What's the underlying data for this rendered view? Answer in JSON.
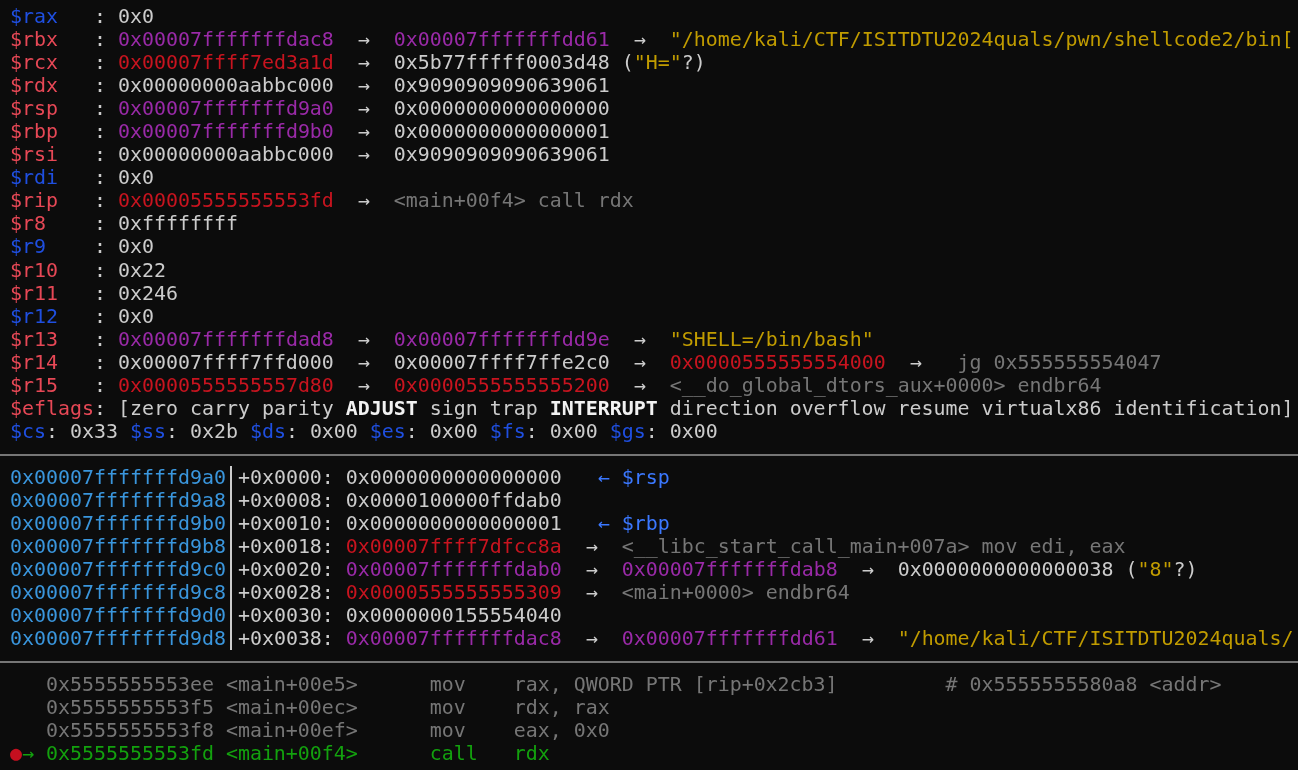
{
  "registers": [
    [
      {
        "kind": "reg_blue",
        "text": "$rax"
      },
      {
        "kind": "plain",
        "text": "   : 0x0"
      }
    ],
    [
      {
        "kind": "reg_red",
        "text": "$rbx"
      },
      {
        "kind": "plain",
        "text": "   : "
      },
      {
        "kind": "purple",
        "text": "0x00007fffffffdac8"
      },
      {
        "kind": "arrow",
        "text": "  →  "
      },
      {
        "kind": "purple",
        "text": "0x00007fffffffdd61"
      },
      {
        "kind": "arrow",
        "text": "  →  "
      },
      {
        "kind": "yellow",
        "text": "\"/home/kali/CTF/ISITDTU2024quals/pwn/shellcode2/bin["
      }
    ],
    [
      {
        "kind": "reg_red",
        "text": "$rcx"
      },
      {
        "kind": "plain",
        "text": "   : "
      },
      {
        "kind": "red",
        "text": "0x00007ffff7ed3a1d"
      },
      {
        "kind": "arrow",
        "text": "  →  "
      },
      {
        "kind": "plain",
        "text": "0x5b77fffff0003d48 ("
      },
      {
        "kind": "yellow",
        "text": "\"H=\""
      },
      {
        "kind": "plain",
        "text": "?)"
      }
    ],
    [
      {
        "kind": "reg_red",
        "text": "$rdx"
      },
      {
        "kind": "plain",
        "text": "   : 0x00000000aabbc000"
      },
      {
        "kind": "arrow",
        "text": "  →  "
      },
      {
        "kind": "plain",
        "text": "0x9090909090639061"
      }
    ],
    [
      {
        "kind": "reg_red",
        "text": "$rsp"
      },
      {
        "kind": "plain",
        "text": "   : "
      },
      {
        "kind": "purple",
        "text": "0x00007fffffffd9a0"
      },
      {
        "kind": "arrow",
        "text": "  →  "
      },
      {
        "kind": "plain",
        "text": "0x0000000000000000"
      }
    ],
    [
      {
        "kind": "reg_red",
        "text": "$rbp"
      },
      {
        "kind": "plain",
        "text": "   : "
      },
      {
        "kind": "purple",
        "text": "0x00007fffffffd9b0"
      },
      {
        "kind": "arrow",
        "text": "  →  "
      },
      {
        "kind": "plain",
        "text": "0x0000000000000001"
      }
    ],
    [
      {
        "kind": "reg_red",
        "text": "$rsi"
      },
      {
        "kind": "plain",
        "text": "   : 0x00000000aabbc000"
      },
      {
        "kind": "arrow",
        "text": "  →  "
      },
      {
        "kind": "plain",
        "text": "0x9090909090639061"
      }
    ],
    [
      {
        "kind": "reg_blue",
        "text": "$rdi"
      },
      {
        "kind": "plain",
        "text": "   : 0x0"
      }
    ],
    [
      {
        "kind": "reg_red",
        "text": "$rip"
      },
      {
        "kind": "plain",
        "text": "   : "
      },
      {
        "kind": "red",
        "text": "0x00005555555553fd"
      },
      {
        "kind": "arrow",
        "text": "  →  "
      },
      {
        "kind": "grey",
        "text": "<main+00f4> call rdx"
      }
    ],
    [
      {
        "kind": "reg_red",
        "text": "$r8"
      },
      {
        "kind": "plain",
        "text": "    : 0xffffffff"
      }
    ],
    [
      {
        "kind": "reg_blue",
        "text": "$r9"
      },
      {
        "kind": "plain",
        "text": "    : 0x0"
      }
    ],
    [
      {
        "kind": "reg_red",
        "text": "$r10"
      },
      {
        "kind": "plain",
        "text": "   : 0x22"
      }
    ],
    [
      {
        "kind": "reg_red",
        "text": "$r11"
      },
      {
        "kind": "plain",
        "text": "   : 0x246"
      }
    ],
    [
      {
        "kind": "reg_blue",
        "text": "$r12"
      },
      {
        "kind": "plain",
        "text": "   : 0x0"
      }
    ],
    [
      {
        "kind": "reg_red",
        "text": "$r13"
      },
      {
        "kind": "plain",
        "text": "   : "
      },
      {
        "kind": "purple",
        "text": "0x00007fffffffdad8"
      },
      {
        "kind": "arrow",
        "text": "  →  "
      },
      {
        "kind": "purple",
        "text": "0x00007fffffffdd9e"
      },
      {
        "kind": "arrow",
        "text": "  →  "
      },
      {
        "kind": "yellow",
        "text": "\"SHELL=/bin/bash\""
      }
    ],
    [
      {
        "kind": "reg_red",
        "text": "$r14"
      },
      {
        "kind": "plain",
        "text": "   : 0x00007ffff7ffd000"
      },
      {
        "kind": "arrow",
        "text": "  →  "
      },
      {
        "kind": "plain",
        "text": "0x00007ffff7ffe2c0"
      },
      {
        "kind": "arrow",
        "text": "  →  "
      },
      {
        "kind": "red",
        "text": "0x0000555555554000"
      },
      {
        "kind": "arrow",
        "text": "  →  "
      },
      {
        "kind": "grey",
        "text": " jg 0x555555554047"
      }
    ],
    [
      {
        "kind": "reg_red",
        "text": "$r15"
      },
      {
        "kind": "plain",
        "text": "   : "
      },
      {
        "kind": "red",
        "text": "0x0000555555557d80"
      },
      {
        "kind": "arrow",
        "text": "  →  "
      },
      {
        "kind": "red",
        "text": "0x0000555555555200"
      },
      {
        "kind": "arrow",
        "text": "  →  "
      },
      {
        "kind": "grey",
        "text": "<__do_global_dtors_aux+0000> endbr64"
      }
    ],
    [
      {
        "kind": "reg_red",
        "text": "$eflags"
      },
      {
        "kind": "plain",
        "text": ": [zero carry parity "
      },
      {
        "kind": "bold",
        "text": "ADJUST"
      },
      {
        "kind": "plain",
        "text": " sign trap "
      },
      {
        "kind": "bold",
        "text": "INTERRUPT"
      },
      {
        "kind": "plain",
        "text": " direction overflow resume virtualx86 identification]"
      }
    ],
    [
      {
        "kind": "reg_blue",
        "text": "$cs"
      },
      {
        "kind": "plain",
        "text": ": 0x33 "
      },
      {
        "kind": "reg_blue",
        "text": "$ss"
      },
      {
        "kind": "plain",
        "text": ": 0x2b "
      },
      {
        "kind": "reg_blue",
        "text": "$ds"
      },
      {
        "kind": "plain",
        "text": ": 0x00 "
      },
      {
        "kind": "reg_blue",
        "text": "$es"
      },
      {
        "kind": "plain",
        "text": ": 0x00 "
      },
      {
        "kind": "reg_blue",
        "text": "$fs"
      },
      {
        "kind": "plain",
        "text": ": 0x00 "
      },
      {
        "kind": "reg_blue",
        "text": "$gs"
      },
      {
        "kind": "plain",
        "text": ": 0x00"
      }
    ]
  ],
  "stack": [
    {
      "address": "0x00007fffffffd9a0",
      "segments": [
        {
          "kind": "plain",
          "text": "+0x0000: 0x0000000000000000"
        },
        {
          "kind": "blue",
          "text": "   ← $rsp"
        }
      ]
    },
    {
      "address": "0x00007fffffffd9a8",
      "segments": [
        {
          "kind": "plain",
          "text": "+0x0008: 0x0000100000ffdab0"
        }
      ]
    },
    {
      "address": "0x00007fffffffd9b0",
      "segments": [
        {
          "kind": "plain",
          "text": "+0x0010: 0x0000000000000001"
        },
        {
          "kind": "blue",
          "text": "   ← $rbp"
        }
      ]
    },
    {
      "address": "0x00007fffffffd9b8",
      "segments": [
        {
          "kind": "plain",
          "text": "+0x0018: "
        },
        {
          "kind": "red",
          "text": "0x00007ffff7dfcc8a"
        },
        {
          "kind": "arrow",
          "text": "  →  "
        },
        {
          "kind": "grey",
          "text": "<__libc_start_call_main+007a> mov edi, eax"
        }
      ]
    },
    {
      "address": "0x00007fffffffd9c0",
      "segments": [
        {
          "kind": "plain",
          "text": "+0x0020: "
        },
        {
          "kind": "purple",
          "text": "0x00007fffffffdab0"
        },
        {
          "kind": "arrow",
          "text": "  →  "
        },
        {
          "kind": "purple",
          "text": "0x00007fffffffdab8"
        },
        {
          "kind": "arrow",
          "text": "  →  "
        },
        {
          "kind": "plain",
          "text": "0x0000000000000038 ("
        },
        {
          "kind": "yellow",
          "text": "\"8\""
        },
        {
          "kind": "plain",
          "text": "?)"
        }
      ]
    },
    {
      "address": "0x00007fffffffd9c8",
      "segments": [
        {
          "kind": "plain",
          "text": "+0x0028: "
        },
        {
          "kind": "red",
          "text": "0x0000555555555309"
        },
        {
          "kind": "arrow",
          "text": "  →  "
        },
        {
          "kind": "grey",
          "text": "<main+0000> endbr64"
        }
      ]
    },
    {
      "address": "0x00007fffffffd9d0",
      "segments": [
        {
          "kind": "plain",
          "text": "+0x0030: 0x0000000155554040"
        }
      ]
    },
    {
      "address": "0x00007fffffffd9d8",
      "segments": [
        {
          "kind": "plain",
          "text": "+0x0038: "
        },
        {
          "kind": "purple",
          "text": "0x00007fffffffdac8"
        },
        {
          "kind": "arrow",
          "text": "  →  "
        },
        {
          "kind": "purple",
          "text": "0x00007fffffffdd61"
        },
        {
          "kind": "arrow",
          "text": "  →  "
        },
        {
          "kind": "yellow",
          "text": "\"/home/kali/CTF/ISITDTU2024quals/"
        }
      ]
    }
  ],
  "code": [
    [
      {
        "kind": "grey",
        "text": "   0x5555555553ee <main+00e5>      mov    rax, QWORD PTR [rip+0x2cb3]         # 0x5555555580a8 <addr>"
      }
    ],
    [
      {
        "kind": "grey",
        "text": "   0x5555555553f5 <main+00ec>      mov    rdx, rax"
      }
    ],
    [
      {
        "kind": "grey",
        "text": "   0x5555555553f8 <main+00ef>      mov    eax, 0x0"
      }
    ],
    [
      {
        "kind": "dot",
        "text": "●"
      },
      {
        "kind": "green",
        "text": "→ 0x5555555553fd <main+00f4>      call   rdx"
      }
    ]
  ]
}
